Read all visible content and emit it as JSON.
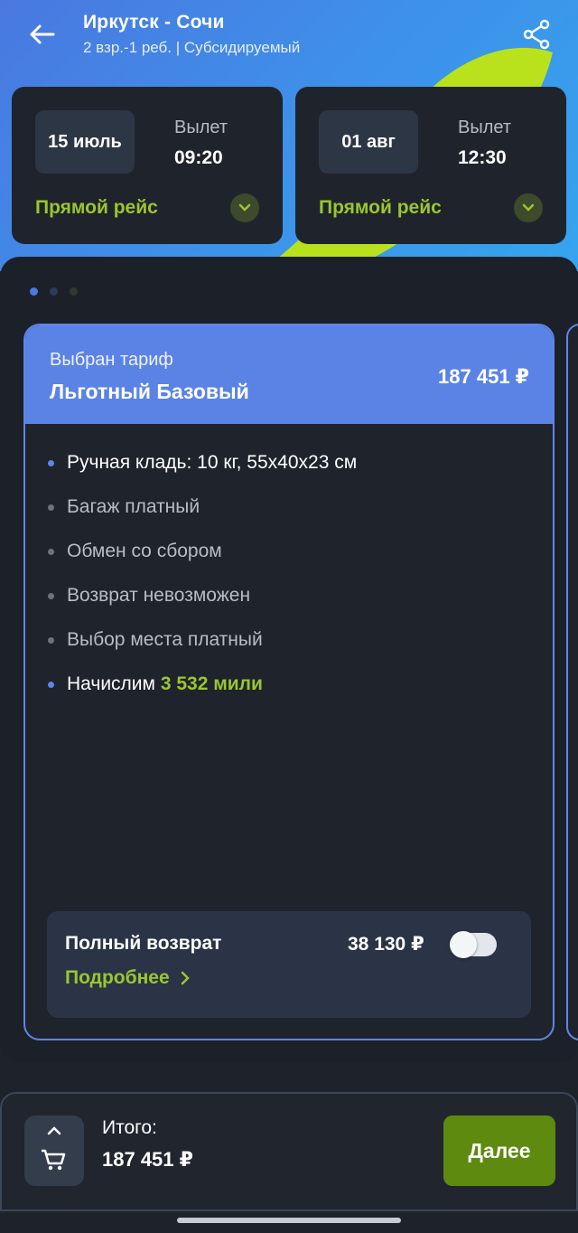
{
  "header": {
    "route": "Иркутск - Сочи",
    "subtitle": "2 взр.-1 реб. | Субсидируемый",
    "back_icon": "arrow-left-icon",
    "share_icon": "share-icon"
  },
  "flights": [
    {
      "date": "15 июль",
      "departure_label": "Вылет",
      "departure_time": "09:20",
      "type": "Прямой рейс"
    },
    {
      "date": "01 авг",
      "departure_label": "Вылет",
      "departure_time": "12:30",
      "type": "Прямой рейс"
    }
  ],
  "pager": {
    "pages": 3,
    "active": 1
  },
  "tariff": {
    "chosen_label": "Выбран тариф",
    "name": "Льготный Базовый",
    "price": "187 451 ₽",
    "features": [
      "Ручная кладь: 10 кг, 55x40x23 см",
      "Багаж платный",
      "Обмен со сбором",
      "Возврат невозможен",
      "Выбор места платный"
    ],
    "miles_prefix": "Начислим",
    "miles_value": "3 532 мили"
  },
  "refund": {
    "title": "Полный возврат",
    "price": "38 130 ₽",
    "enabled": false,
    "more_label": "Подробнее"
  },
  "footer": {
    "total_label": "Итого:",
    "total_value": "187 451 ₽",
    "next_label": "Далее",
    "cart_icon": "cart-icon"
  },
  "colors": {
    "accent_green": "#9bc62d",
    "accent_blue": "#5b83e6",
    "button_green": "#5e8a10",
    "background": "#1c2028"
  }
}
